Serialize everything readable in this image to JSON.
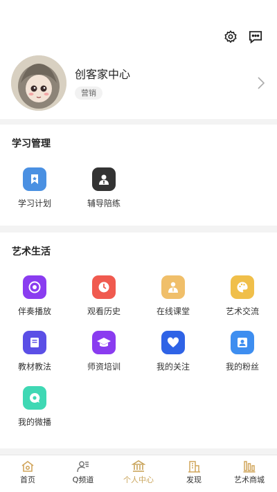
{
  "profile": {
    "name": "创客家中心",
    "tag": "营销"
  },
  "sections": {
    "study": {
      "title": "学习管理",
      "items": [
        {
          "label": "学习计划",
          "icon": "bookmark-icon",
          "color": "#4a90e2"
        },
        {
          "label": "辅导陪练",
          "icon": "tutor-icon",
          "color": "#333333"
        }
      ]
    },
    "art": {
      "title": "艺术生活",
      "items": [
        {
          "label": "伴奏播放",
          "icon": "play-disc-icon",
          "color": "#8a3cf0"
        },
        {
          "label": "观看历史",
          "icon": "clock-icon",
          "color": "#f05a4f"
        },
        {
          "label": "在线课堂",
          "icon": "teacher-icon",
          "color": "#f0bf6a"
        },
        {
          "label": "艺术交流",
          "icon": "palette-icon",
          "color": "#f0bf4a"
        },
        {
          "label": "教材教法",
          "icon": "book-icon",
          "color": "#5b4fe6"
        },
        {
          "label": "师资培训",
          "icon": "graduation-cap-icon",
          "color": "#8a3cf0"
        },
        {
          "label": "我的关注",
          "icon": "heart-icon",
          "color": "#2f63e6"
        },
        {
          "label": "我的粉丝",
          "icon": "fan-user-icon",
          "color": "#3e8ef0"
        },
        {
          "label": "我的微播",
          "icon": "chat-bubble-icon",
          "color": "#3fd8b4"
        }
      ]
    }
  },
  "tabbar": {
    "items": [
      {
        "label": "首页",
        "icon": "home-icon"
      },
      {
        "label": "Q频道",
        "icon": "channel-icon"
      },
      {
        "label": "个人中心",
        "icon": "bank-icon",
        "active": true
      },
      {
        "label": "发现",
        "icon": "discover-icon"
      },
      {
        "label": "艺术商城",
        "icon": "mall-icon"
      }
    ],
    "active_color": "#c9a45a"
  }
}
